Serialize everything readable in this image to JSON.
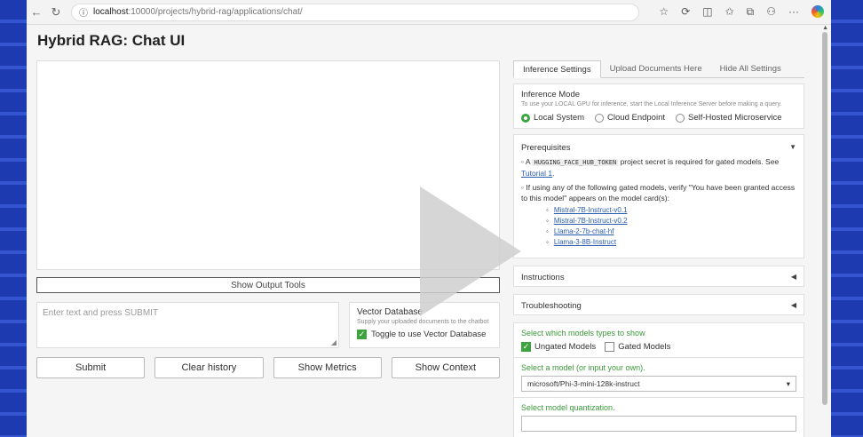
{
  "browser": {
    "url_host": "localhost",
    "url_path": ":10000/projects/hybrid-rag/applications/chat/"
  },
  "app": {
    "title": "Hybrid RAG: Chat UI"
  },
  "chat": {
    "output_tools_label": "Show Output Tools",
    "input_placeholder": "Enter text and press SUBMIT"
  },
  "vector_db": {
    "title": "Vector Database",
    "subtitle": "Supply your uploaded documents to the chatbot",
    "toggle_label": "Toggle to use Vector Database"
  },
  "buttons": {
    "submit": "Submit",
    "clear": "Clear history",
    "metrics": "Show Metrics",
    "context": "Show Context"
  },
  "tabs": [
    "Inference Settings",
    "Upload Documents Here",
    "Hide All Settings"
  ],
  "inference": {
    "title": "Inference Mode",
    "subtitle": "To use your LOCAL GPU for inference, start the Local Inference Server before making a query.",
    "options": [
      "Local System",
      "Cloud Endpoint",
      "Self-Hosted Microservice"
    ]
  },
  "prereq": {
    "title": "Prerequisites",
    "line1_pre": "A",
    "token": "HUGGING_FACE_HUB_TOKEN",
    "line1_post": "project secret is required for gated models. See",
    "tutorial": "Tutorial 1",
    "line2": "If using any of the following gated models, verify \"You have been granted access to this model\" appears on the model card(s):",
    "models": [
      "Mistral-7B-Instruct-v0.1",
      "Mistral-7B-Instruct-v0.2",
      "Llama-2-7b-chat-hf",
      "Llama-3-8B-Instruct"
    ]
  },
  "accordions": {
    "instructions": "Instructions",
    "troubleshooting": "Troubleshooting"
  },
  "model_types": {
    "label": "Select which models types to show",
    "ungated": "Ungated Models",
    "gated": "Gated Models"
  },
  "model_select": {
    "label": "Select a model (or input your own).",
    "value": "microsoft/Phi-3-mini-128k-instruct"
  },
  "quantization": {
    "label": "Select model quantization."
  },
  "colors": {
    "accent_green": "#3ea33e",
    "link_blue": "#2a5db0",
    "bg_blue": "#1f3aa8"
  }
}
